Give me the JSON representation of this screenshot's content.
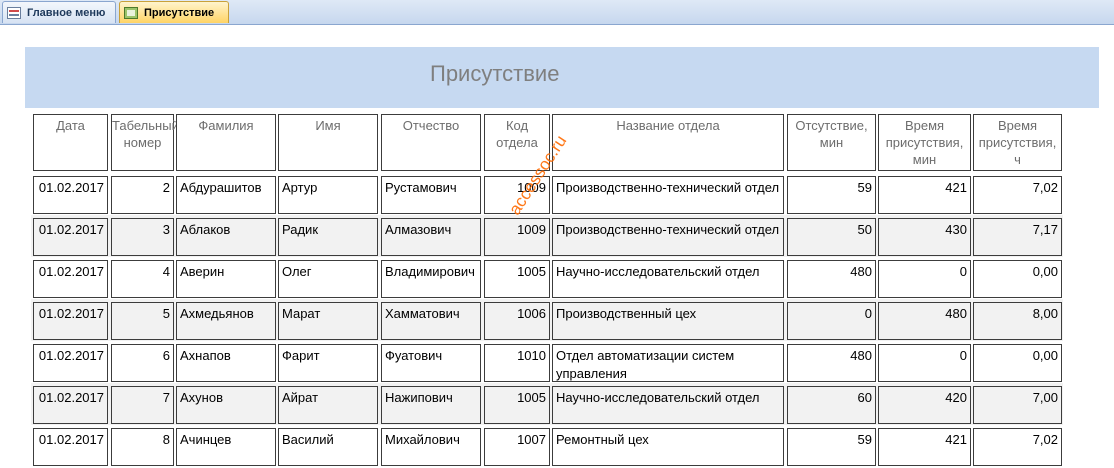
{
  "tabs": [
    {
      "label": "Главное меню",
      "icon": "form-icon",
      "active": false
    },
    {
      "label": "Присутствие",
      "icon": "report-icon",
      "active": true
    }
  ],
  "report": {
    "title": "Присутствие"
  },
  "columns": [
    "Дата",
    "Табельный номер",
    "Фамилия",
    "Имя",
    "Отчество",
    "Код отдела",
    "Название отдела",
    "Отсутствие, мин",
    "Время присутствия, мин",
    "Время присутствия, ч"
  ],
  "rows": [
    [
      "01.02.2017",
      "2",
      "Абдурашитов",
      "Артур",
      "Рустамович",
      "1009",
      "Производственно-технический отдел",
      "59",
      "421",
      "7,02"
    ],
    [
      "01.02.2017",
      "3",
      "Аблаков",
      "Радик",
      "Алмазович",
      "1009",
      "Производственно-технический отдел",
      "50",
      "430",
      "7,17"
    ],
    [
      "01.02.2017",
      "4",
      "Аверин",
      "Олег",
      "Владимирович",
      "1005",
      "Научно-исследовательский отдел",
      "480",
      "0",
      "0,00"
    ],
    [
      "01.02.2017",
      "5",
      "Ахмедьянов",
      "Марат",
      "Хамматович",
      "1006",
      "Производственный цех",
      "0",
      "480",
      "8,00"
    ],
    [
      "01.02.2017",
      "6",
      "Ахнапов",
      "Фарит",
      "Фуатович",
      "1010",
      "Отдел автоматизации систем управления",
      "480",
      "0",
      "0,00"
    ],
    [
      "01.02.2017",
      "7",
      "Ахунов",
      "Айрат",
      "Нажипович",
      "1005",
      "Научно-исследовательский отдел",
      "60",
      "420",
      "7,00"
    ],
    [
      "01.02.2017",
      "8",
      "Ачинцев",
      "Василий",
      "Михайлович",
      "1007",
      "Ремонтный цех",
      "59",
      "421",
      "7,02"
    ]
  ],
  "watermark": "accessoc.ru",
  "colors": {
    "header_band": "#c6d9f1",
    "alt_row": "#f2f2f2",
    "active_tab": "#ffd466",
    "watermark": "#ff6a00"
  }
}
